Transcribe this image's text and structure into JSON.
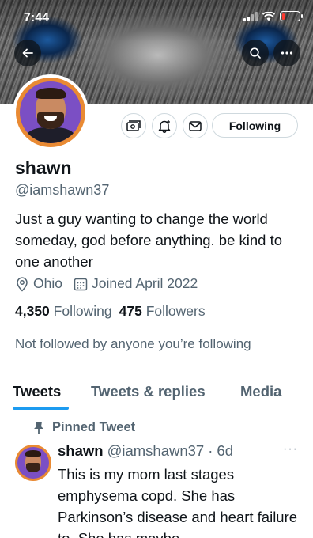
{
  "status_bar": {
    "time": "7:44",
    "battery_level_fraction": 0.15,
    "battery_color": "#ff3b30"
  },
  "header": {
    "back_icon": "arrow-left-icon",
    "search_icon": "search-icon",
    "more_icon": "more-horizontal-icon"
  },
  "profile": {
    "display_name": "shawn",
    "handle": "@iamshawn37",
    "bio": "Just a guy wanting to change the world someday, god before anything. be kind to one another",
    "location": "Ohio",
    "joined": "Joined April 2022",
    "following_count": "4,350",
    "following_label": "Following",
    "followers_count": "475",
    "followers_label": "Followers",
    "not_followed_text": "Not followed by anyone you’re following"
  },
  "actions": {
    "following_button": "Following",
    "icons": [
      "tips-icon",
      "notification-bell-icon",
      "message-icon"
    ]
  },
  "tabs": [
    {
      "label": "Tweets",
      "active": true
    },
    {
      "label": "Tweets & replies",
      "active": false
    },
    {
      "label": "Media",
      "active": false
    }
  ],
  "pinned_tweet": {
    "pinned_label": "Pinned Tweet",
    "author_name": "shawn",
    "author_handle": "@iamshawn37",
    "time": "6d",
    "text": "This is my mom last stages emphysema copd. She has Parkinson’s disease and heart failure to. She has maybe"
  },
  "colors": {
    "accent": "#1d9bf0",
    "text_primary": "#0f1419",
    "text_secondary": "#536471",
    "avatar_ring": "#e98a33",
    "avatar_bg": "#7b4fc4"
  }
}
